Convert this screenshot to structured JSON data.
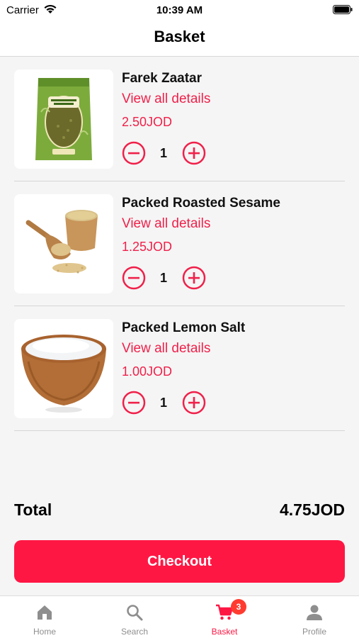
{
  "status_bar": {
    "carrier": "Carrier",
    "time": "10:39 AM"
  },
  "header": {
    "title": "Basket"
  },
  "items": [
    {
      "name": "Farek Zaatar",
      "details_link": "View all details",
      "price": "2.50JOD",
      "quantity": "1",
      "image": "zaatar-package"
    },
    {
      "name": "Packed Roasted Sesame",
      "details_link": "View all details",
      "price": "1.25JOD",
      "quantity": "1",
      "image": "sesame-scoop"
    },
    {
      "name": "Packed Lemon Salt",
      "details_link": "View all details",
      "price": "1.00JOD",
      "quantity": "1",
      "image": "salt-bowl"
    }
  ],
  "summary": {
    "total_label": "Total",
    "total_value": "4.75JOD"
  },
  "checkout": {
    "label": "Checkout"
  },
  "tabs": [
    {
      "label": "Home",
      "icon": "home-icon",
      "active": false
    },
    {
      "label": "Search",
      "icon": "search-icon",
      "active": false
    },
    {
      "label": "Basket",
      "icon": "cart-icon",
      "active": true,
      "badge": "3"
    },
    {
      "label": "Profile",
      "icon": "person-icon",
      "active": false
    }
  ],
  "colors": {
    "accent": "#ff1744",
    "price": "#f0204a",
    "badge": "#ff3b30",
    "inactive_tab": "#8e8e8e"
  }
}
